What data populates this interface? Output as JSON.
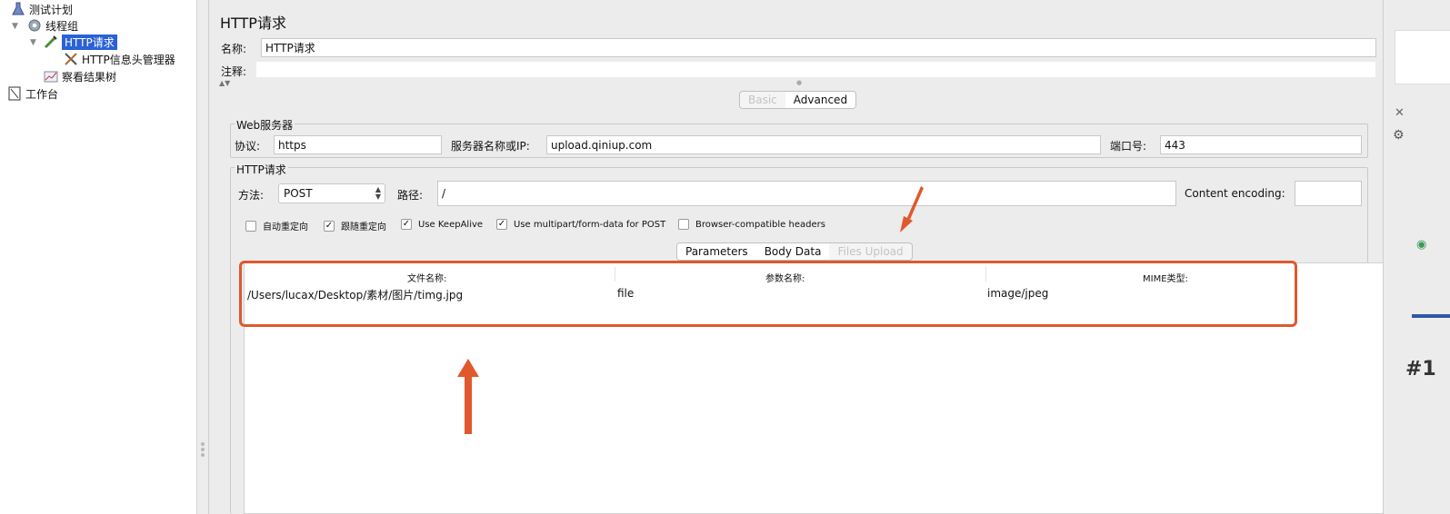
{
  "tree": {
    "items": [
      {
        "label": "测试计划"
      },
      {
        "label": "线程组"
      },
      {
        "label": "HTTP请求"
      },
      {
        "label": "HTTP信息头管理器"
      },
      {
        "label": "察看结果树"
      },
      {
        "label": "工作台"
      }
    ]
  },
  "panel": {
    "title": "HTTP请求",
    "name_label": "名称:",
    "name_value": "HTTP请求",
    "comment_label": "注释:",
    "comment_value": ""
  },
  "mode_tabs": {
    "basic": "Basic",
    "advanced": "Advanced"
  },
  "web_server": {
    "group_title": "Web服务器",
    "protocol_label": "协议:",
    "protocol_value": "https",
    "server_label": "服务器名称或IP:",
    "server_value": "upload.qiniup.com",
    "port_label": "端口号:",
    "port_value": "443"
  },
  "http_request": {
    "group_title": "HTTP请求",
    "method_label": "方法:",
    "method_value": "POST",
    "path_label": "路径:",
    "path_value": "/",
    "encoding_label": "Content encoding:",
    "encoding_value": ""
  },
  "options": [
    {
      "label": "自动重定向",
      "checked": false
    },
    {
      "label": "跟随重定向",
      "checked": true
    },
    {
      "label": "Use KeepAlive",
      "checked": true
    },
    {
      "label": "Use multipart/form-data for POST",
      "checked": true
    },
    {
      "label": "Browser-compatible headers",
      "checked": false
    }
  ],
  "sub_tabs": {
    "parameters": "Parameters",
    "body_data": "Body Data",
    "files_upload": "Files Upload"
  },
  "files_table": {
    "headers": [
      "文件名称:",
      "参数名称:",
      "MIME类型:"
    ],
    "rows": [
      [
        "/Users/lucax/Desktop/素材/图片/timg.jpg",
        "file",
        "image/jpeg"
      ]
    ]
  },
  "colors": {
    "selection": "#2a62d6",
    "annotation": "#e0582c"
  },
  "right_edge_text": "#1"
}
